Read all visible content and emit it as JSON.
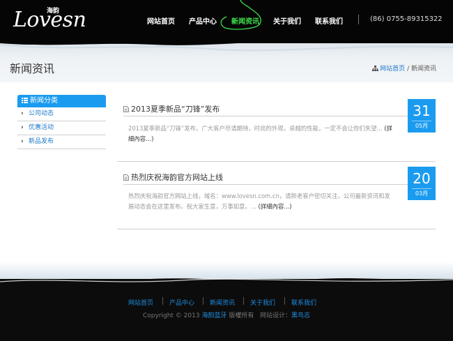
{
  "header": {
    "logo_text": "Lovesn",
    "logo_cn": "海韵",
    "nav": [
      "网站首页",
      "产品中心",
      "新闻资讯",
      "关于我们",
      "联系我们"
    ],
    "active_nav": "新闻资讯",
    "phone": "(86) 0755-89315322"
  },
  "page": {
    "title": "新闻资讯",
    "breadcrumb": {
      "home": "网站首页",
      "separator": "/",
      "current": "新闻资讯"
    }
  },
  "sidebar": {
    "title": "新闻分类",
    "items": [
      {
        "label": "公司动态"
      },
      {
        "label": "优惠活动"
      },
      {
        "label": "新品发布"
      }
    ]
  },
  "articles": [
    {
      "title": "2013夏季新品“刀锋”发布",
      "summary": "2013夏季新品“刀锋”发布，广大客户尽请期待，时尚的外观，卓越的性能，一定不会让你们失望...",
      "more": "(詳細內容...)",
      "day": "31",
      "month": "05月"
    },
    {
      "title": "热烈庆祝海韵官方网站上线",
      "summary": "热烈庆祝海韵官方网站上线，域名：www.lovesn.com.cn，请新老客户密切关注，公司最新资讯和发展动态会在这里发布。祝大家生意，万事如意。...",
      "more": "(詳細內容...)",
      "day": "20",
      "month": "03月"
    }
  ],
  "footer": {
    "nav": [
      "网站首页",
      "产品中心",
      "新闻资讯",
      "关于我们",
      "联系我们"
    ],
    "copyright_prefix": "Copyright © 2013",
    "company": "海韵蓝牙",
    "rights": "版權所有",
    "design_label": "网站设计：",
    "designer": "黑鸟志"
  },
  "colors": {
    "accent": "#1a9bef",
    "active_nav": "#3ee04d",
    "link": "#1f78c8",
    "header_bg": "#050505",
    "footer_bg": "#0c0c0c"
  }
}
